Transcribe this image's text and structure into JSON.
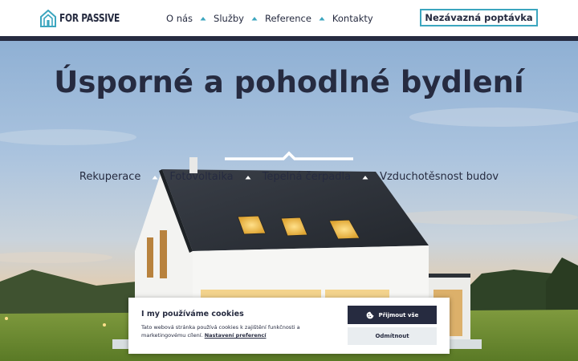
{
  "header": {
    "logo_text": "FOR PASSIVE",
    "nav": [
      {
        "label": "O nás"
      },
      {
        "label": "Služby"
      },
      {
        "label": "Reference"
      },
      {
        "label": "Kontakty"
      }
    ],
    "cta_label": "Nezávazná poptávka"
  },
  "hero": {
    "title": "Úsporné a pohodlné bydlení",
    "links": [
      {
        "label": "Rekuperace"
      },
      {
        "label": "Fotovoltaika"
      },
      {
        "label": "Tepelná čerpadla"
      },
      {
        "label": "Vzduchotěsnost budov"
      }
    ]
  },
  "cookie": {
    "title": "I my používáme cookies",
    "text": "Tato webová stránka používá cookies k zajištění funkčnosti a marketingovému cílení.",
    "link": "Nastavení preferencí",
    "accept_label": "Přijmout vše",
    "decline_label": "Odmítnout"
  },
  "colors": {
    "navy": "#262b40",
    "accent": "#3ca6bf"
  },
  "icons": {
    "logo": "house-logo-icon",
    "separator": "chevron-up-icon",
    "cookie": "cookie-icon"
  }
}
